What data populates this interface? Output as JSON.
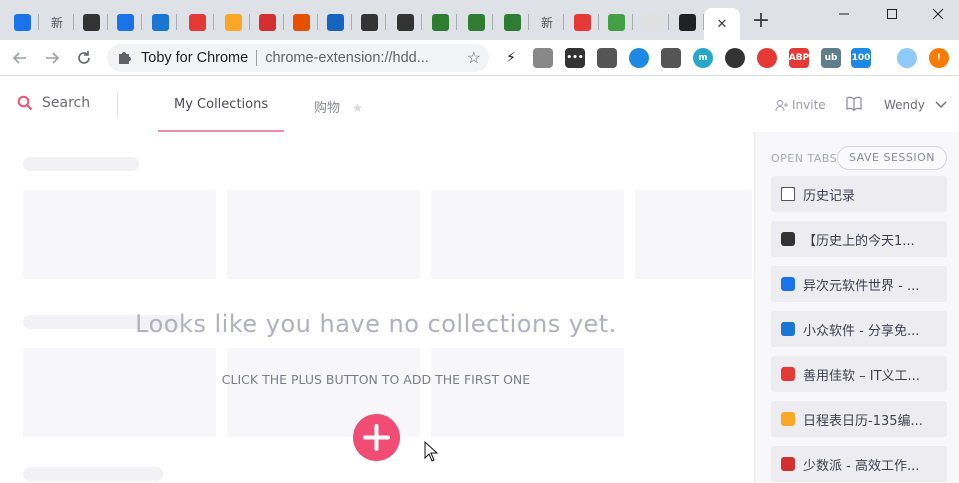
{
  "browser": {
    "tabs": [
      {
        "icon": "history-icon",
        "color": "#1a73e8",
        "text": ""
      },
      {
        "icon": "xin-icon",
        "color": "#555",
        "text": "新"
      },
      {
        "icon": "soccer-icon",
        "color": "#333",
        "text": ""
      },
      {
        "icon": "butterfly-icon",
        "color": "#1a73e8",
        "text": ""
      },
      {
        "icon": "water-drop-icon",
        "color": "#1976d2",
        "text": ""
      },
      {
        "icon": "shanyong-icon",
        "color": "#e53935",
        "text": ""
      },
      {
        "icon": "calendar-icon",
        "color": "#f9a825",
        "text": ""
      },
      {
        "icon": "sspai-icon",
        "color": "#d32f2f",
        "text": ""
      },
      {
        "icon": "tiger-icon",
        "color": "#e65100",
        "text": ""
      },
      {
        "icon": "ps-icon",
        "color": "#1565c0",
        "text": ""
      },
      {
        "icon": "rocket-icon",
        "color": "#333",
        "text": ""
      },
      {
        "icon": "rocket-icon",
        "color": "#333",
        "text": ""
      },
      {
        "icon": "book-green-icon",
        "color": "#2e7d32",
        "text": ""
      },
      {
        "icon": "book-green-icon",
        "color": "#2e7d32",
        "text": ""
      },
      {
        "icon": "book-green-icon",
        "color": "#2e7d32",
        "text": ""
      },
      {
        "icon": "xin-icon",
        "color": "#555",
        "text": "新"
      },
      {
        "icon": "weibo-icon",
        "color": "#e53935",
        "text": ""
      },
      {
        "icon": "wechat-icon",
        "color": "#43a047",
        "text": ""
      },
      {
        "icon": "blank-page-icon",
        "color": "#e0e0e0",
        "text": ""
      },
      {
        "icon": "toby-icon",
        "color": "#202124",
        "text": ""
      }
    ],
    "active_tab_close": "✕",
    "new_tab": "+",
    "omnibox_title": "Toby for Chrome",
    "omnibox_url": "chrome-extension://hdd...",
    "extensions": [
      {
        "icon": "bolt-icon",
        "color": "#202124",
        "text": "⚡"
      },
      {
        "icon": "toby-small-icon",
        "color": "#888",
        "text": ""
      },
      {
        "icon": "dots-icon",
        "color": "#333",
        "text": "•••"
      },
      {
        "icon": "aperture-icon",
        "color": "#555",
        "text": ""
      },
      {
        "icon": "key-icon",
        "color": "#1e88e5",
        "text": ""
      },
      {
        "icon": "bulb-icon",
        "color": "#555",
        "text": ""
      },
      {
        "icon": "m-icon",
        "color": "#26a6c9",
        "text": "m"
      },
      {
        "icon": "eye-icon",
        "color": "#333",
        "text": ""
      },
      {
        "icon": "tampermonkey-icon",
        "color": "#e53935",
        "text": ""
      },
      {
        "icon": "abp-icon",
        "color": "#e53935",
        "text": "ABP"
      },
      {
        "icon": "ublock-icon",
        "color": "#607d8b",
        "text": "ub"
      },
      {
        "icon": "tab-counter-icon",
        "color": "#1e88e5",
        "text": "100"
      },
      {
        "icon": "weather-icon",
        "color": "#90caf9",
        "text": ""
      },
      {
        "icon": "alert-icon",
        "color": "#f57c00",
        "text": "!"
      }
    ]
  },
  "app": {
    "search_label": "Search",
    "tabs": [
      {
        "label": "My Collections"
      },
      {
        "label": "购物"
      }
    ],
    "invite_label": "Invite",
    "user_name": "Wendy"
  },
  "main": {
    "empty_title": "Looks like you have no collections yet.",
    "empty_subtitle": "CLICK THE PLUS BUTTON TO ADD THE FIRST ONE"
  },
  "panel": {
    "open_tabs_label": "OPEN TABS",
    "save_session_label": "SAVE SESSION",
    "tabs": [
      {
        "title": "历史记录",
        "icon": "page-icon",
        "color": "#ffffff"
      },
      {
        "title": "【历史上的今天1...",
        "icon": "soccer-icon",
        "color": "#333333"
      },
      {
        "title": "异次元软件世界 - ...",
        "icon": "butterfly-icon",
        "color": "#1a73e8"
      },
      {
        "title": "小众软件 - 分享免...",
        "icon": "water-drop-icon",
        "color": "#1976d2"
      },
      {
        "title": "善用佳软 – IT义工...",
        "icon": "shanyong-icon",
        "color": "#e53935"
      },
      {
        "title": "日程表日历-135编...",
        "icon": "calendar-icon",
        "color": "#f9a825"
      },
      {
        "title": "少数派 - 高效工作...",
        "icon": "sspai-icon",
        "color": "#d32f2f"
      }
    ]
  }
}
